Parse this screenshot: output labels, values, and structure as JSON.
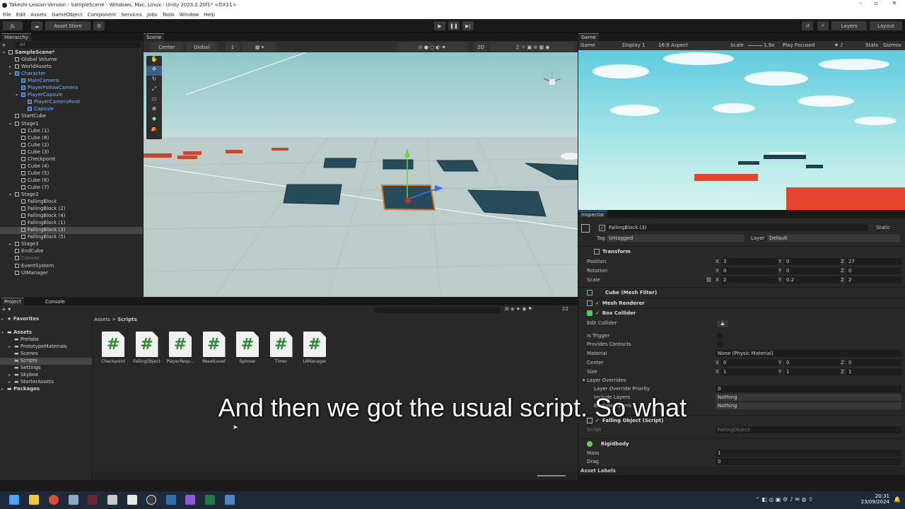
{
  "window": {
    "title": "Takeshi-Lesson-Version - SampleScene - Windows, Mac, Linux - Unity 2023.2.20f1* <DX11>"
  },
  "menu": [
    "File",
    "Edit",
    "Assets",
    "GameObject",
    "Component",
    "Services",
    "Jobs",
    "Tools",
    "Window",
    "Help"
  ],
  "toolbar": {
    "account": "JL",
    "asset_store": "Asset Store",
    "layers": "Layers",
    "layout": "Layout"
  },
  "hierarchy": {
    "tab": "Hierarchy",
    "search_placeholder": "All",
    "items": [
      {
        "label": "SampleScene*",
        "indent": 0,
        "style": "bold"
      },
      {
        "label": "Global Volume",
        "indent": 1,
        "style": "normal"
      },
      {
        "label": "WorldAssets",
        "indent": 1,
        "style": "normal"
      },
      {
        "label": "Character",
        "indent": 1,
        "style": "blue"
      },
      {
        "label": "MainCamera",
        "indent": 2,
        "style": "blue"
      },
      {
        "label": "PlayerFollowCamera",
        "indent": 2,
        "style": "blue"
      },
      {
        "label": "PlayerCapsule",
        "indent": 2,
        "style": "blue"
      },
      {
        "label": "PlayerCameraRoot",
        "indent": 3,
        "style": "blue"
      },
      {
        "label": "Capsule",
        "indent": 3,
        "style": "blue"
      },
      {
        "label": "StartCube",
        "indent": 1,
        "style": "normal"
      },
      {
        "label": "Stage1",
        "indent": 1,
        "style": "normal"
      },
      {
        "label": "Cube (1)",
        "indent": 2,
        "style": "normal"
      },
      {
        "label": "Cube (8)",
        "indent": 2,
        "style": "normal"
      },
      {
        "label": "Cube (2)",
        "indent": 2,
        "style": "normal"
      },
      {
        "label": "Cube (3)",
        "indent": 2,
        "style": "normal"
      },
      {
        "label": "Checkpoint",
        "indent": 2,
        "style": "normal"
      },
      {
        "label": "Cube (4)",
        "indent": 2,
        "style": "normal"
      },
      {
        "label": "Cube (5)",
        "indent": 2,
        "style": "normal"
      },
      {
        "label": "Cube (6)",
        "indent": 2,
        "style": "normal"
      },
      {
        "label": "Cube (7)",
        "indent": 2,
        "style": "normal"
      },
      {
        "label": "Stage2",
        "indent": 1,
        "style": "normal"
      },
      {
        "label": "FallingBlock",
        "indent": 2,
        "style": "normal"
      },
      {
        "label": "FallingBlock (2)",
        "indent": 2,
        "style": "normal"
      },
      {
        "label": "FallingBlock (4)",
        "indent": 2,
        "style": "normal"
      },
      {
        "label": "FallingBlock (1)",
        "indent": 2,
        "style": "normal"
      },
      {
        "label": "FallingBlock (3)",
        "indent": 2,
        "style": "selected"
      },
      {
        "label": "FallingBlock (5)",
        "indent": 2,
        "style": "normal"
      },
      {
        "label": "Stage3",
        "indent": 1,
        "style": "normal"
      },
      {
        "label": "EndCube",
        "indent": 1,
        "style": "normal"
      },
      {
        "label": "Canvas",
        "indent": 1,
        "style": "dim"
      },
      {
        "label": "EventSystem",
        "indent": 1,
        "style": "normal"
      },
      {
        "label": "UIManager",
        "indent": 1,
        "style": "normal"
      }
    ]
  },
  "scene": {
    "tab": "Scene",
    "pivot": "Center",
    "space": "Global",
    "grid_value": "1",
    "mode_2d": "2D"
  },
  "game": {
    "tab": "Game",
    "view": "Game",
    "display": "Display 1",
    "aspect": "16:9 Aspect",
    "scale_label": "Scale",
    "scale_value": "1.9x",
    "play_focused": "Play Focused",
    "stats": "Stats",
    "gizmos": "Gizmos"
  },
  "project": {
    "tabs": [
      "Project",
      "Console"
    ],
    "favorites": "Favorites",
    "assets_root": "Assets",
    "folders": [
      "Prefabs",
      "PrototypeMaterials",
      "Scenes",
      "Scripts",
      "Settings",
      "Skybox",
      "StarterAssets"
    ],
    "packages": "Packages",
    "breadcrumb": [
      "Assets",
      "Scripts"
    ],
    "files": [
      "Checkpoint",
      "FallingObject",
      "PlayerResp...",
      "ResetLevel",
      "Spinner",
      "Timer",
      "UIManager"
    ],
    "count": "22"
  },
  "inspector": {
    "tab": "Inspector",
    "object_name": "FallingBlock (3)",
    "static": "Static",
    "tag_label": "Tag",
    "tag": "Untagged",
    "layer_label": "Layer",
    "layer": "Default",
    "transform": {
      "title": "Transform",
      "position": {
        "label": "Position",
        "x": "3",
        "y": "0",
        "z": "27"
      },
      "rotation": {
        "label": "Rotation",
        "x": "0",
        "y": "0",
        "z": "0"
      },
      "scale": {
        "label": "Scale",
        "x": "2",
        "y": "0.2",
        "z": "2"
      }
    },
    "mesh_filter": "Cube (Mesh Filter)",
    "mesh_renderer": "Mesh Renderer",
    "box_collider": {
      "title": "Box Collider",
      "edit_collider": "Edit Collider",
      "is_trigger": "Is Trigger",
      "provides_contacts": "Provides Contacts",
      "material_label": "Material",
      "material": "None (Physic Material)",
      "center": {
        "label": "Center",
        "x": "0",
        "y": "0",
        "z": "0"
      },
      "size": {
        "label": "Size",
        "x": "1",
        "y": "1",
        "z": "1"
      },
      "layer_overrides": "Layer Overrides",
      "priority_label": "Layer Override Priority",
      "priority": "0",
      "include_label": "Include Layers",
      "include": "Nothing",
      "exclude_label": "Exclude Layers",
      "exclude": "Nothing"
    },
    "script_component": {
      "title": "Falling Object (Script)",
      "script_label": "Script",
      "script": "FallingObject"
    },
    "rigidbody": {
      "title": "Rigidbody",
      "mass_label": "Mass",
      "mass": "1",
      "drag_label": "Drag",
      "drag": "0"
    },
    "asset_labels": "Asset Labels"
  },
  "subtitle": "And then we got the usual script. So what",
  "taskbar": {
    "time": "20:31",
    "date": "23/09/2024"
  }
}
